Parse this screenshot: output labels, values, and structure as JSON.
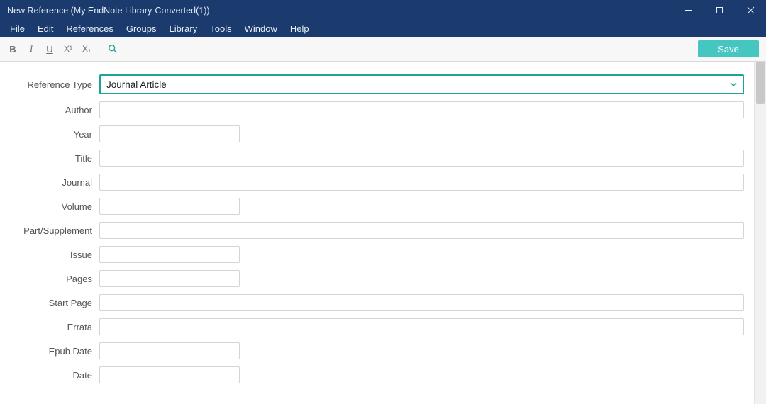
{
  "window": {
    "title": "New Reference (My EndNote Library-Converted(1))"
  },
  "menu": {
    "items": [
      "File",
      "Edit",
      "References",
      "Groups",
      "Library",
      "Tools",
      "Window",
      "Help"
    ]
  },
  "toolbar": {
    "bold": "B",
    "italic": "I",
    "underline": "U",
    "superscript": "X¹",
    "subscript": "X₁",
    "save_label": "Save"
  },
  "form": {
    "reference_type_label": "Reference Type",
    "reference_type_value": "Journal Article",
    "fields": [
      {
        "label": "Author",
        "size": "full",
        "value": ""
      },
      {
        "label": "Year",
        "size": "short",
        "value": ""
      },
      {
        "label": "Title",
        "size": "full",
        "value": ""
      },
      {
        "label": "Journal",
        "size": "full",
        "value": ""
      },
      {
        "label": "Volume",
        "size": "short",
        "value": ""
      },
      {
        "label": "Part/Supplement",
        "size": "full",
        "value": ""
      },
      {
        "label": "Issue",
        "size": "short",
        "value": ""
      },
      {
        "label": "Pages",
        "size": "short",
        "value": ""
      },
      {
        "label": "Start Page",
        "size": "full",
        "value": ""
      },
      {
        "label": "Errata",
        "size": "full",
        "value": ""
      },
      {
        "label": "Epub Date",
        "size": "short",
        "value": ""
      },
      {
        "label": "Date",
        "size": "short",
        "value": ""
      }
    ]
  }
}
